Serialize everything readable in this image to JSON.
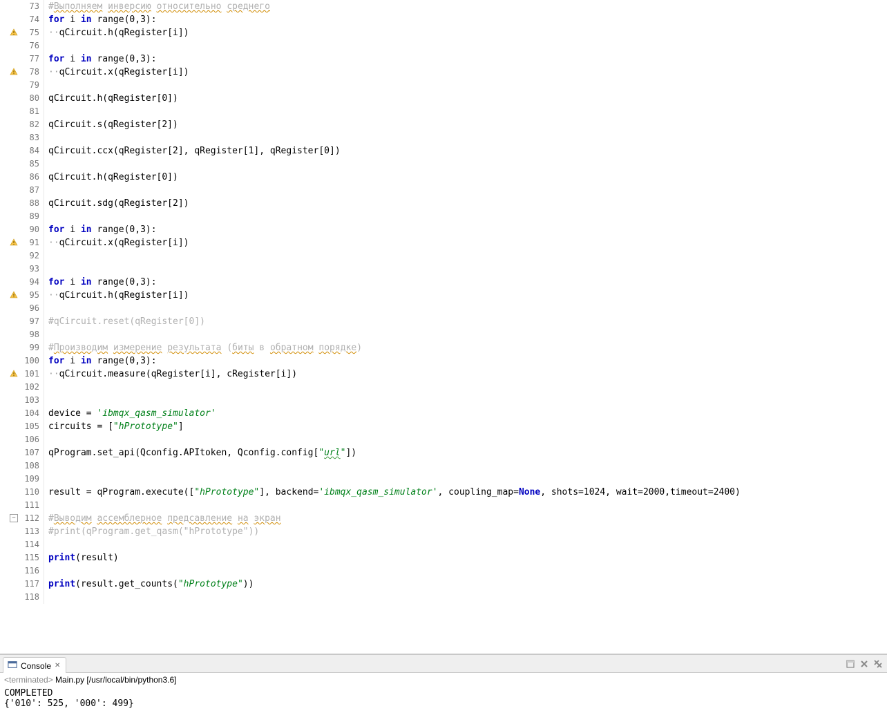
{
  "editor": {
    "first_line": 73,
    "lines": [
      {
        "n": 73,
        "warn": false,
        "tokens": [
          {
            "t": "#",
            "c": "comment"
          },
          {
            "t": "Выполняем",
            "c": "comment spellcheck"
          },
          {
            "t": " ",
            "c": "comment"
          },
          {
            "t": "инверсию",
            "c": "comment spellcheck"
          },
          {
            "t": " ",
            "c": "comment"
          },
          {
            "t": "относительно",
            "c": "comment spellcheck"
          },
          {
            "t": " ",
            "c": "comment"
          },
          {
            "t": "среднего",
            "c": "comment spellcheck"
          }
        ]
      },
      {
        "n": 74,
        "warn": false,
        "tokens": [
          {
            "t": "for",
            "c": "kw"
          },
          {
            "t": " i "
          },
          {
            "t": "in",
            "c": "kw"
          },
          {
            "t": " range(0,3):"
          }
        ]
      },
      {
        "n": 75,
        "warn": true,
        "tokens": [
          {
            "t": "··",
            "c": "dot"
          },
          {
            "t": "qCircuit.h(qRegister[i])"
          }
        ]
      },
      {
        "n": 76,
        "warn": false,
        "tokens": []
      },
      {
        "n": 77,
        "warn": false,
        "tokens": [
          {
            "t": "for",
            "c": "kw"
          },
          {
            "t": " i "
          },
          {
            "t": "in",
            "c": "kw"
          },
          {
            "t": " range(0,3):"
          }
        ]
      },
      {
        "n": 78,
        "warn": true,
        "tokens": [
          {
            "t": "··",
            "c": "dot"
          },
          {
            "t": "qCircuit.x(qRegister[i])"
          }
        ]
      },
      {
        "n": 79,
        "warn": false,
        "tokens": []
      },
      {
        "n": 80,
        "warn": false,
        "tokens": [
          {
            "t": "qCircuit.h(qRegister[0])"
          }
        ]
      },
      {
        "n": 81,
        "warn": false,
        "tokens": []
      },
      {
        "n": 82,
        "warn": false,
        "tokens": [
          {
            "t": "qCircuit.s(qRegister[2])"
          }
        ]
      },
      {
        "n": 83,
        "warn": false,
        "tokens": []
      },
      {
        "n": 84,
        "warn": false,
        "tokens": [
          {
            "t": "qCircuit.ccx(qRegister[2], qRegister[1], qRegister[0])"
          }
        ]
      },
      {
        "n": 85,
        "warn": false,
        "tokens": []
      },
      {
        "n": 86,
        "warn": false,
        "tokens": [
          {
            "t": "qCircuit.h(qRegister[0])"
          }
        ]
      },
      {
        "n": 87,
        "warn": false,
        "tokens": []
      },
      {
        "n": 88,
        "warn": false,
        "tokens": [
          {
            "t": "qCircuit.sdg(qRegister[2])"
          }
        ]
      },
      {
        "n": 89,
        "warn": false,
        "tokens": []
      },
      {
        "n": 90,
        "warn": false,
        "tokens": [
          {
            "t": "for",
            "c": "kw"
          },
          {
            "t": " i "
          },
          {
            "t": "in",
            "c": "kw"
          },
          {
            "t": " range(0,3):"
          }
        ]
      },
      {
        "n": 91,
        "warn": true,
        "tokens": [
          {
            "t": "··",
            "c": "dot"
          },
          {
            "t": "qCircuit.x(qRegister[i])"
          }
        ]
      },
      {
        "n": 92,
        "warn": false,
        "tokens": []
      },
      {
        "n": 93,
        "warn": false,
        "tokens": []
      },
      {
        "n": 94,
        "warn": false,
        "tokens": [
          {
            "t": "for",
            "c": "kw"
          },
          {
            "t": " i "
          },
          {
            "t": "in",
            "c": "kw"
          },
          {
            "t": " range(0,3):"
          }
        ]
      },
      {
        "n": 95,
        "warn": true,
        "tokens": [
          {
            "t": "··",
            "c": "dot"
          },
          {
            "t": "qCircuit.h(qRegister[i])"
          }
        ]
      },
      {
        "n": 96,
        "warn": false,
        "tokens": []
      },
      {
        "n": 97,
        "warn": false,
        "tokens": [
          {
            "t": "#qCircuit.reset(qRegister[0])",
            "c": "comment"
          }
        ]
      },
      {
        "n": 98,
        "warn": false,
        "tokens": []
      },
      {
        "n": 99,
        "warn": false,
        "tokens": [
          {
            "t": "#",
            "c": "comment"
          },
          {
            "t": "Производим",
            "c": "comment spellcheck"
          },
          {
            "t": " ",
            "c": "comment"
          },
          {
            "t": "измерение",
            "c": "comment spellcheck"
          },
          {
            "t": " ",
            "c": "comment"
          },
          {
            "t": "результата",
            "c": "comment spellcheck"
          },
          {
            "t": " (",
            "c": "comment"
          },
          {
            "t": "биты",
            "c": "comment spellcheck"
          },
          {
            "t": " в ",
            "c": "comment"
          },
          {
            "t": "обратном",
            "c": "comment spellcheck"
          },
          {
            "t": " ",
            "c": "comment"
          },
          {
            "t": "порядке",
            "c": "comment spellcheck"
          },
          {
            "t": ")",
            "c": "comment"
          }
        ]
      },
      {
        "n": 100,
        "warn": false,
        "tokens": [
          {
            "t": "for",
            "c": "kw"
          },
          {
            "t": " i "
          },
          {
            "t": "in",
            "c": "kw"
          },
          {
            "t": " range(0,3):"
          }
        ]
      },
      {
        "n": 101,
        "warn": true,
        "tokens": [
          {
            "t": "··",
            "c": "dot"
          },
          {
            "t": "qCircuit.measure(qRegister[i], cRegister[i])"
          }
        ]
      },
      {
        "n": 102,
        "warn": false,
        "tokens": []
      },
      {
        "n": 103,
        "warn": false,
        "tokens": []
      },
      {
        "n": 104,
        "warn": false,
        "tokens": [
          {
            "t": "device = "
          },
          {
            "t": "'ibmqx_qasm_simulator'",
            "c": "str"
          }
        ]
      },
      {
        "n": 105,
        "warn": false,
        "tokens": [
          {
            "t": "circuits = ["
          },
          {
            "t": "\"hPrototype\"",
            "c": "str"
          },
          {
            "t": "]"
          }
        ]
      },
      {
        "n": 106,
        "warn": false,
        "tokens": []
      },
      {
        "n": 107,
        "warn": false,
        "tokens": [
          {
            "t": "qProgram.set_api(Qconfig.APItoken, Qconfig.config["
          },
          {
            "t": "\"",
            "c": "str"
          },
          {
            "t": "url",
            "c": "str spell-green"
          },
          {
            "t": "\"",
            "c": "str"
          },
          {
            "t": "])"
          }
        ]
      },
      {
        "n": 108,
        "warn": false,
        "tokens": []
      },
      {
        "n": 109,
        "warn": false,
        "tokens": []
      },
      {
        "n": 110,
        "warn": false,
        "tokens": [
          {
            "t": "result = qProgram.execute(["
          },
          {
            "t": "\"hPrototype\"",
            "c": "str"
          },
          {
            "t": "], backend="
          },
          {
            "t": "'ibmqx_qasm_simulator'",
            "c": "str"
          },
          {
            "t": ", coupling_map="
          },
          {
            "t": "None",
            "c": "builtin"
          },
          {
            "t": ", shots=1024, wait=2000,timeout=2400)"
          }
        ]
      },
      {
        "n": 111,
        "warn": false,
        "tokens": []
      },
      {
        "n": 112,
        "warn": false,
        "fold": true,
        "tokens": [
          {
            "t": "#",
            "c": "comment"
          },
          {
            "t": "Выводим",
            "c": "comment spellcheck"
          },
          {
            "t": " ",
            "c": "comment"
          },
          {
            "t": "ассемблерное",
            "c": "comment spellcheck"
          },
          {
            "t": " ",
            "c": "comment"
          },
          {
            "t": "предсавление",
            "c": "comment spellcheck"
          },
          {
            "t": " ",
            "c": "comment"
          },
          {
            "t": "на",
            "c": "comment spellcheck"
          },
          {
            "t": " ",
            "c": "comment"
          },
          {
            "t": "экран",
            "c": "comment spellcheck"
          }
        ]
      },
      {
        "n": 113,
        "warn": false,
        "tokens": [
          {
            "t": "#print(qProgram.get_qasm(\"hPrototype\"))",
            "c": "comment"
          }
        ]
      },
      {
        "n": 114,
        "warn": false,
        "tokens": []
      },
      {
        "n": 115,
        "warn": false,
        "tokens": [
          {
            "t": "print",
            "c": "kw"
          },
          {
            "t": "(result)"
          }
        ]
      },
      {
        "n": 116,
        "warn": false,
        "tokens": []
      },
      {
        "n": 117,
        "warn": false,
        "tokens": [
          {
            "t": "print",
            "c": "kw"
          },
          {
            "t": "(result.get_counts("
          },
          {
            "t": "\"hPrototype\"",
            "c": "str"
          },
          {
            "t": "))"
          }
        ]
      },
      {
        "n": 118,
        "warn": false,
        "tokens": []
      }
    ]
  },
  "console": {
    "tab_label": "Console",
    "tab_close_glyph": "✕",
    "header_prefix": "<terminated>",
    "header_main": " Main.py [/usr/local/bin/python3.6]",
    "output": "COMPLETED\n{'010': 525, '000': 499}"
  }
}
